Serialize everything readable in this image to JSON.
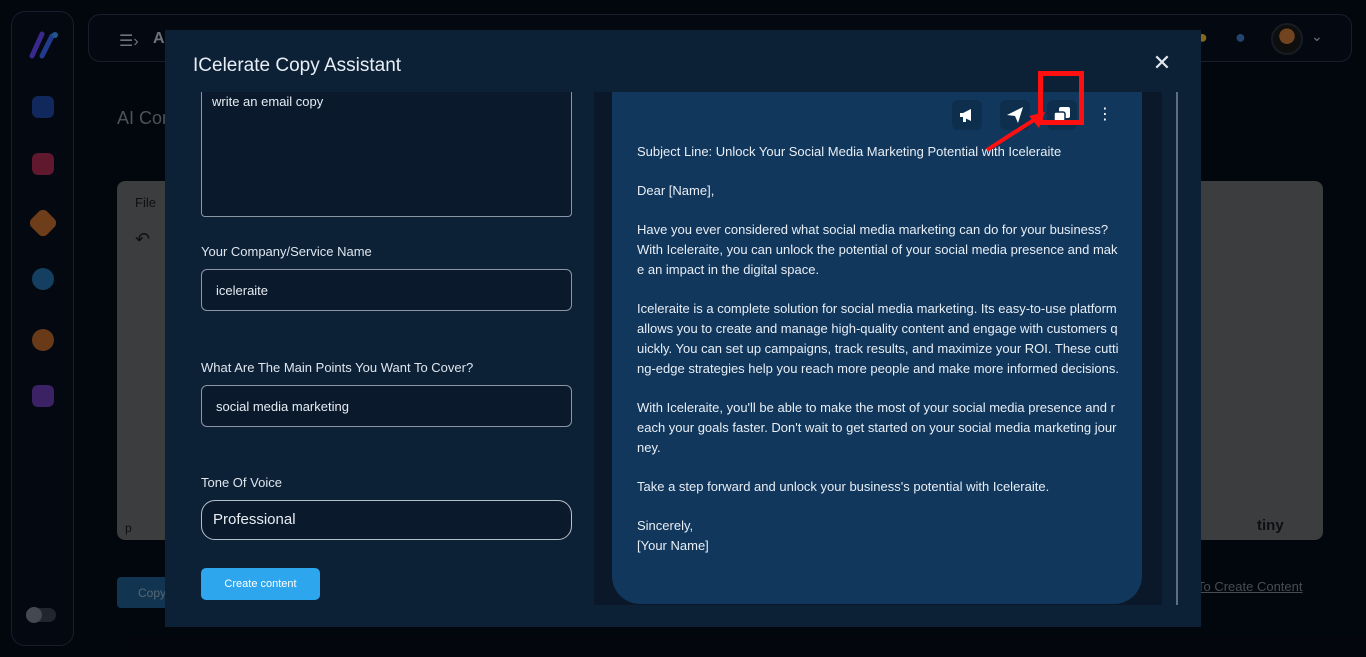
{
  "background": {
    "topbar_letter": "A",
    "page_title": "AI Cor",
    "editor": {
      "menu_file": "File",
      "status_path": "p",
      "brand": "tiny"
    },
    "copy_button": "Copy",
    "link_text": "t To Create Content"
  },
  "modal": {
    "title": "ICelerate Copy Assistant",
    "prompt_value": "write an email copy",
    "company_label": "Your Company/Service Name",
    "company_value": "iceleraite",
    "points_label": "What Are The Main Points You Want To Cover?",
    "points_value": "social media marketing",
    "tone_label": "Tone Of Voice",
    "tone_value": "Professional",
    "create_button": "Create content"
  },
  "output": {
    "toolbar_icons": [
      "megaphone-icon",
      "send-icon",
      "copy-icon",
      "more-vertical-icon"
    ],
    "subject": "Subject Line: Unlock Your Social Media Marketing Potential with Iceleraite",
    "greeting": "Dear [Name],",
    "p1": "Have you ever considered what social media marketing can do for your business? With Iceleraite, you can unlock the potential of your social media presence and make an impact in the digital space.",
    "p2": "Iceleraite is a complete solution for social media marketing. Its easy-to-use platform allows you to create and manage high-quality content and engage with customers quickly. You can set up campaigns, track results, and maximize your ROI. These cutting-edge strategies help you reach more people and make more informed decisions.",
    "p3": "With Iceleraite, you'll be able to make the most of your social media presence and reach your goals faster. Don't wait to get started on your social media marketing journey.",
    "p4": "Take a step forward and unlock your business's potential with Iceleraite.",
    "signoff": "Sincerely,",
    "signature": "[Your Name]"
  },
  "colors": {
    "accent": "#2ea6ee",
    "highlight": "#ff1010",
    "modal_bg": "#0c2036",
    "card_bg": "#11375c"
  }
}
